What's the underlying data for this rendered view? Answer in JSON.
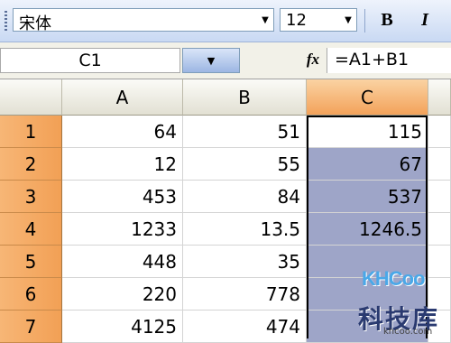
{
  "toolbar": {
    "font_name": "宋体",
    "font_size": "12",
    "bold_label": "B",
    "italic_label": "I"
  },
  "formula_bar": {
    "name_box": "C1",
    "fx_label": "fx",
    "formula": "=A1+B1"
  },
  "grid": {
    "columns": [
      "A",
      "B",
      "C"
    ],
    "rows": [
      {
        "num": "1",
        "A": "64",
        "B": "51",
        "C": "115"
      },
      {
        "num": "2",
        "A": "12",
        "B": "55",
        "C": "67"
      },
      {
        "num": "3",
        "A": "453",
        "B": "84",
        "C": "537"
      },
      {
        "num": "4",
        "A": "1233",
        "B": "13.5",
        "C": "1246.5"
      },
      {
        "num": "5",
        "A": "448",
        "B": "35",
        "C": ""
      },
      {
        "num": "6",
        "A": "220",
        "B": "778",
        "C": ""
      },
      {
        "num": "7",
        "A": "4125",
        "B": "474",
        "C": ""
      }
    ]
  },
  "watermark": {
    "logo": "KHCoo",
    "cn": "科技库",
    "url": "khcoo.com"
  },
  "colors": {
    "active_header": "#f3a25a",
    "selection": "#9ea5c8"
  }
}
